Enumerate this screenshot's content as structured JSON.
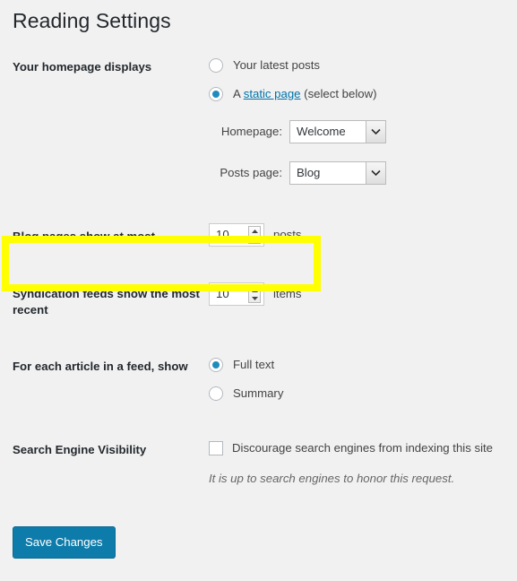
{
  "page": {
    "title": "Reading Settings",
    "background_color": "#f1f1f1",
    "accent_color": "#0073aa",
    "highlight_color": "#ffff00"
  },
  "homepage_displays": {
    "label": "Your homepage displays",
    "options": [
      {
        "label": "Your latest posts",
        "selected": false
      },
      {
        "label_prefix": "A ",
        "link_text": "static page",
        "label_suffix": " (select below)",
        "selected": true
      }
    ],
    "selects": [
      {
        "caption": "Homepage:",
        "value": "Welcome"
      },
      {
        "caption": "Posts page:",
        "value": "Blog"
      }
    ]
  },
  "blog_pages": {
    "label": "Blog pages show at most",
    "value": "10",
    "unit": "posts",
    "highlighted": true
  },
  "syndication_feeds": {
    "label": "Syndication feeds show the most recent",
    "value": "10",
    "unit": "items"
  },
  "feed_article": {
    "label": "For each article in a feed, show",
    "options": [
      {
        "label": "Full text",
        "selected": true
      },
      {
        "label": "Summary",
        "selected": false
      }
    ]
  },
  "search_engine_visibility": {
    "label": "Search Engine Visibility",
    "checkbox_label": "Discourage search engines from indexing this site",
    "checked": false,
    "description": "It is up to search engines to honor this request."
  },
  "submit": {
    "save_label": "Save Changes"
  }
}
